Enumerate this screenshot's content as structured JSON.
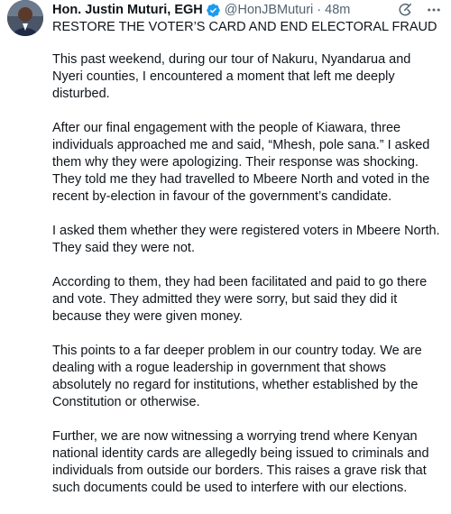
{
  "author": {
    "name": "Hon. Justin Muturi, EGH",
    "handle": "@HonJBMuturi",
    "separator": "·",
    "time": "48m"
  },
  "post": {
    "title": "RESTORE THE VOTER’S CARD AND END ELECTORAL FRAUD",
    "paragraphs": [
      "This past weekend, during our tour of Nakuru, Nyandarua and Nyeri counties, I encountered a moment that left me deeply disturbed.",
      "After our final engagement with the people of Kiawara, three individuals approached me and said, “Mhesh, pole sana.” I asked them why they were apologizing. Their response was shocking. They told me they had travelled to Mbeere North and voted in the recent by-election in favour of the government’s candidate.",
      "I asked them whether they were registered voters in Mbeere North. They said they were not.",
      "According to them, they had been facilitated and paid to go there and vote. They admitted they were sorry, but said they did it because they were given money.",
      "This points to a far deeper problem in our country today. We are dealing with a rogue leadership in government that shows absolutely no regard for institutions, whether established by the Constitution or otherwise.",
      "Further, we are now witnessing a worrying trend where Kenyan national identity cards are allegedly being issued to criminals and individuals from outside our borders. This raises a grave risk that such documents could be used to interfere with our elections."
    ]
  },
  "icons": {
    "verified": "verified-badge-icon",
    "grok": "grok-icon",
    "more": "more-icon"
  },
  "colors": {
    "text": "#0f1419",
    "secondary": "#536471",
    "verified": "#1d9bf0"
  }
}
